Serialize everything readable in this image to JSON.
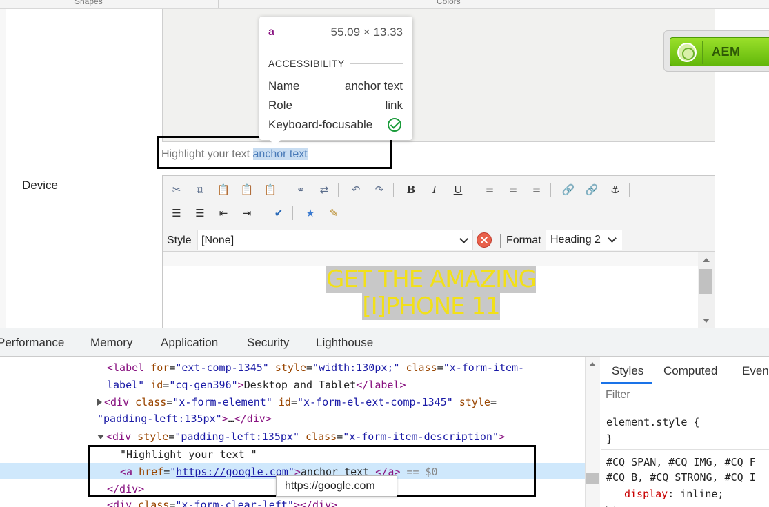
{
  "top_strip": {
    "left_label": "Shapes",
    "right_label": "Colors"
  },
  "aem_button": {
    "label": "AEM"
  },
  "inspect_tooltip": {
    "tag": "a",
    "size": "55.09 × 13.33",
    "section": "ACCESSIBILITY",
    "name_key": "Name",
    "name_value": "anchor text",
    "role_key": "Role",
    "role_value": "link",
    "focus_key": "Keyboard-focusable"
  },
  "description": {
    "plain": "Highlight your text ",
    "selected": "anchor text"
  },
  "device_label": "Device",
  "rte": {
    "style_label": "Style",
    "style_value": "[None]",
    "format_label": "Format",
    "format_value": "Heading 2",
    "headline_line1": "GET THE AMAZING",
    "headline_line2": "[I]PHONE 11",
    "headline_color": "#f2e018"
  },
  "devtools": {
    "tabs": [
      "Performance",
      "Memory",
      "Application",
      "Security",
      "Lighthouse"
    ],
    "code": {
      "label_for": "ext-comp-1345",
      "label_style": "width:130px;",
      "label_class_1": "x-form-item-",
      "label_class_2": "label",
      "label_id": "cq-gen396",
      "label_text": "Desktop and Tablet",
      "div1_class": "x-form-element",
      "div1_id": "x-form-el-ext-comp-1345",
      "div1_style": "padding-left:135px",
      "div2_style": "padding-left:135px",
      "div2_class": "x-form-item-description",
      "text_node": "\"Highlight your text \"",
      "anchor_href": "https://google.com",
      "anchor_text": "anchor text ",
      "dollar": "== $0",
      "div3_class": "x-form-clear-left"
    },
    "url_tooltip": "https://google.com",
    "styles_tabs": [
      "Styles",
      "Computed",
      "Event"
    ],
    "filter_placeholder": "Filter",
    "element_style": "element.style {",
    "close_brace": "}",
    "rule_selector_1": "#CQ SPAN, #CQ IMG, #CQ F",
    "rule_selector_2": "#CQ B, #CQ STRONG, #CQ I",
    "rule_prop": "display",
    "rule_value": "inline;"
  }
}
